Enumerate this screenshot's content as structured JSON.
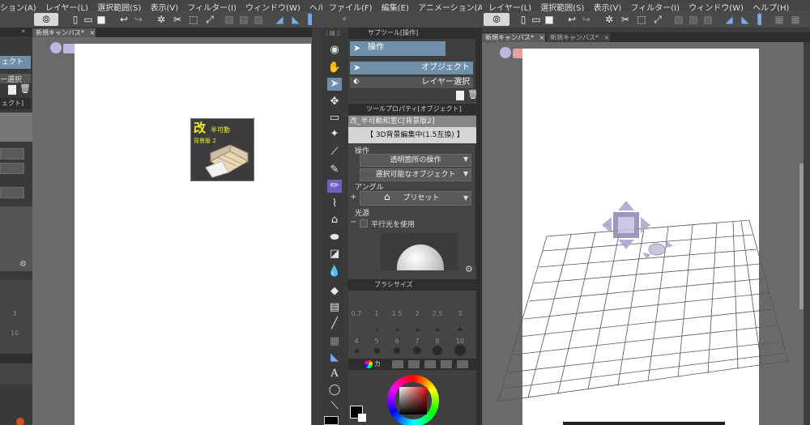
{
  "left_window": {
    "menu": [
      "ション(A)",
      "レイヤー(L)",
      "選択範囲(S)",
      "表示(V)",
      "フィルター(I)",
      "ウィンドウ(W)",
      "ヘルプ"
    ],
    "doc_tab": "新規キャンバス*",
    "side_items": [
      "ェクト",
      "ー選択",
      "ェクト]"
    ],
    "brush_sizes": [
      "3",
      "10"
    ],
    "thumbnail": {
      "title_char": "改",
      "title_small": "半可動",
      "subtitle": "背景版 2"
    }
  },
  "middle_panel": {
    "menu": [
      "ファイル(F)",
      "編集(E)",
      "アニメーション(A)"
    ],
    "subtool_header": "サブツール[操作]",
    "operation_tab": "操作",
    "subtools": [
      "オブジェクト",
      "レイヤー選択"
    ],
    "tool_property_header": "ツールプロパティ[オブジェクト]",
    "object_name": "改_半可動和室C[背景版2]",
    "mode_label": "【 3D背景編集中(1.5互換) 】",
    "operation_label": "操作",
    "operation_target": "透明箇所の操作",
    "selectable_object": "選択可能なオブジェクト",
    "angle_label": "アングル",
    "preset_label": "プリセット",
    "light_label": "光源",
    "parallel_light_label": "平行光を使用",
    "brush_size_header": "ブラシサイズ",
    "brush_sizes_row1": [
      "0.7",
      "1",
      "1.5",
      "2",
      "2.5",
      "3"
    ],
    "brush_sizes_row2": [
      "4",
      "5",
      "6",
      "7",
      "8",
      "10"
    ],
    "color_header": "カ"
  },
  "right_window": {
    "menu": [
      "レイヤー(L)",
      "選択範囲(S)",
      "表示(V)",
      "フィルター(I)",
      "ウィンドウ(W)",
      "ヘルプ(H)"
    ],
    "doc_tabs": [
      "新規キャンバス*",
      "新規キャンバス*"
    ]
  },
  "colors": {
    "app_bg": "#3d3d3d",
    "accent_blue": "#708fa8",
    "selected_tool": "#6f5fc0",
    "manipulator": "#a8a8cc",
    "thumbnail_yellow": "#f0f030"
  }
}
